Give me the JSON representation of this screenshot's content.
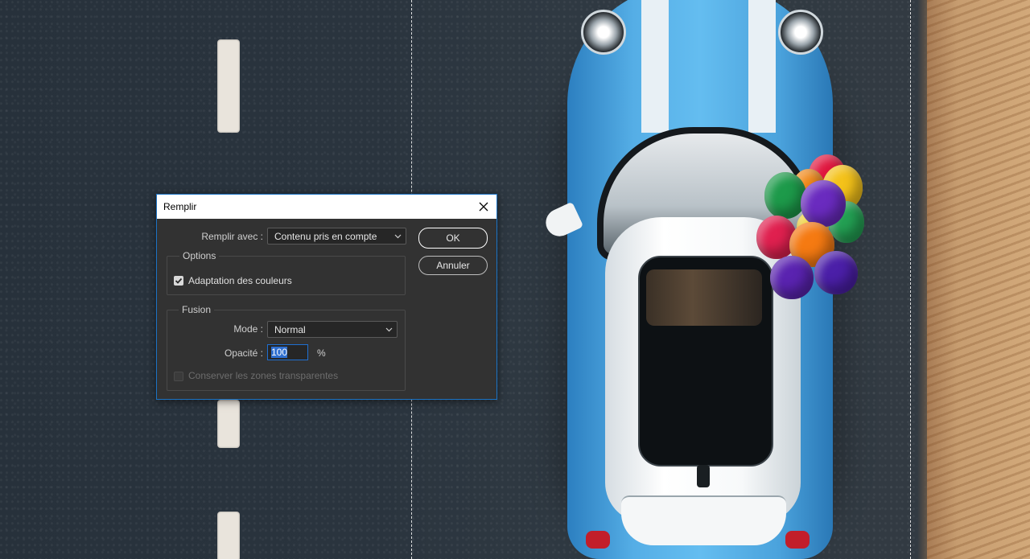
{
  "dialog": {
    "title": "Remplir",
    "close_icon": "close-icon",
    "fill_with_label": "Remplir avec :",
    "fill_with_value": "Contenu pris en compte",
    "ok_label": "OK",
    "cancel_label": "Annuler",
    "options_title": "Options",
    "color_adaptation_label": "Adaptation des couleurs",
    "color_adaptation_checked": true,
    "blending_title": "Fusion",
    "mode_label": "Mode :",
    "mode_value": "Normal",
    "opacity_label": "Opacité :",
    "opacity_value": "100",
    "opacity_unit": "%",
    "preserve_transparency_label": "Conserver les zones transparentes",
    "preserve_transparency_checked": false,
    "preserve_transparency_enabled": false
  },
  "colors": {
    "dialog_bg": "#323232",
    "accent_border": "#1c73c4",
    "selection_highlight": "#2f6fd0"
  },
  "background": {
    "description_icon": "photo-canvas",
    "selection_marquee": "dashed-selection"
  }
}
